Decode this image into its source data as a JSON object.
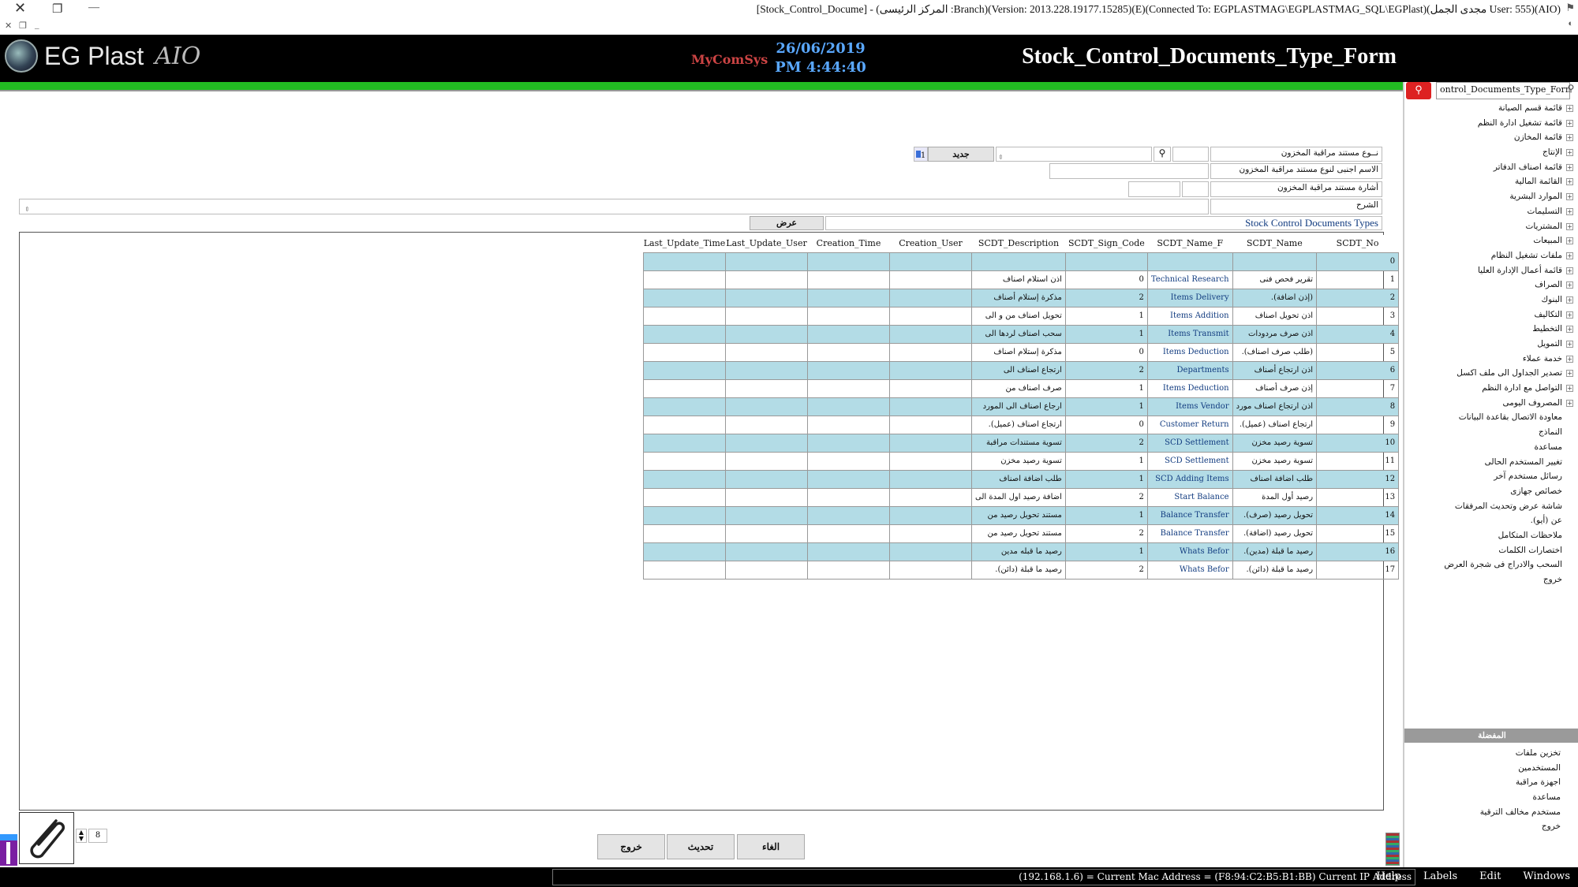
{
  "window": {
    "title": "[Stock_Control_Docume] - (المركز الرئيسى :Branch)(Version: 2013.228.19177.15285)(E)(Connected To: EGPLASTMAG\\EGPLASTMAG_SQL\\EGPlast)(مجدى الجمل User: 555)(AIO)",
    "close": "✕",
    "restore": "❐",
    "minimize": "—"
  },
  "header": {
    "logo_text": "EG Plast",
    "logo_suffix": "AIO",
    "brand": "MyComSys",
    "date": "26/06/2019",
    "time": "PM 4:44:40",
    "form_title": "Stock_Control_Documents_Type_Form"
  },
  "sidebar": {
    "search_value": "ontrol_Documents_Type_Form",
    "search_icon": "search-icon",
    "tree": [
      {
        "label": "قائمة قسم الصيانة",
        "expand": true
      },
      {
        "label": "قائمة تشغيل ادارة النظم",
        "expand": true
      },
      {
        "label": "قائمة المخازن",
        "expand": true
      },
      {
        "label": "الإنتاج",
        "expand": true
      },
      {
        "label": "قائمة اصناف الدفاتر",
        "expand": true
      },
      {
        "label": "القائمة المالية",
        "expand": true
      },
      {
        "label": "الموارد البشرية",
        "expand": true
      },
      {
        "label": "التسليمات",
        "expand": true
      },
      {
        "label": "المشتريات",
        "expand": true
      },
      {
        "label": "المبيعات",
        "expand": true
      },
      {
        "label": "ملفات تشغيل النظام",
        "expand": true
      },
      {
        "label": "قائمة أعمال الإدارة العليا",
        "expand": true
      },
      {
        "label": "الصراف",
        "expand": true
      },
      {
        "label": "البنوك",
        "expand": true
      },
      {
        "label": "التكاليف",
        "expand": true
      },
      {
        "label": "التخطيط",
        "expand": true
      },
      {
        "label": "التمويل",
        "expand": true
      },
      {
        "label": "خدمة عملاء",
        "expand": true
      },
      {
        "label": "تصدير الجداول الى ملف اكسل",
        "expand": true
      },
      {
        "label": "التواصل مع ادارة النظم",
        "expand": true
      },
      {
        "label": "المصروف اليومى",
        "expand": true
      },
      {
        "label": "معاودة الاتصال بقاعدة البيانات",
        "expand": false
      },
      {
        "label": "النماذج",
        "expand": false
      },
      {
        "label": "مساعدة",
        "expand": false
      },
      {
        "label": "تغيير المستخدم الحالى",
        "expand": false
      },
      {
        "label": "رسائل مستخدم آخر",
        "expand": false
      },
      {
        "label": "خصائص جهازى",
        "expand": false
      },
      {
        "label": "شاشة عرض وتحديث المرفقات",
        "expand": false
      },
      {
        "label": "عن (أيو).",
        "expand": false
      },
      {
        "label": "ملاحظات المتكامل",
        "expand": false
      },
      {
        "label": "اختصارات الكلمات",
        "expand": false
      },
      {
        "label": "السحب والادراج فى شجرة العرض",
        "expand": false
      },
      {
        "label": "خروج",
        "expand": false
      }
    ],
    "favorites_header": "المفضلة",
    "favorites": [
      "تخزين ملفات",
      "المستخدمين",
      "اجهزة مراقبة",
      "مساعدة",
      "مستخدم مخالف الترقية",
      "خروج"
    ]
  },
  "form": {
    "type_label": "نــوع مستند مراقبة المخزون",
    "foreign_name_label": "الاسم اجنبى لنوع مستند مراقبة المخزون",
    "sign_label": "أشارة مستند مراقبة المخزون",
    "description_label": "الشرح",
    "new_button": "جديد",
    "counter_value": "1",
    "grid_caption": "Stock Control Documents Types",
    "view_button": "عرض"
  },
  "grid": {
    "columns": [
      "Last_Update_Time",
      "Last_Update_User",
      "Creation_Time",
      "Creation_User",
      "SCDT_Description",
      "SCDT_Sign_Code",
      "SCDT_Name_F",
      "SCDT_Name",
      "SCDT_No"
    ],
    "rows": [
      {
        "no": "0",
        "name": "",
        "name_f": "",
        "sign": "",
        "desc": ""
      },
      {
        "no": "1",
        "name": "تقرير فحص فنى",
        "name_f": "Technical Research",
        "sign": "0",
        "desc": "اذن استلام اصناف"
      },
      {
        "no": "2",
        "name": "(إذن اضافة).",
        "name_f": "Items Delivery",
        "sign": "2",
        "desc": "مذكرة إستلام أصناف"
      },
      {
        "no": "3",
        "name": "اذن تحويل اصناف",
        "name_f": "Items Addition",
        "sign": "1",
        "desc": "تحويل اصناف من و الى"
      },
      {
        "no": "4",
        "name": "اذن صرف مردودات",
        "name_f": "Items Transmit",
        "sign": "1",
        "desc": "سحب اصناف لردها الى"
      },
      {
        "no": "5",
        "name": "(طلب صرف اصناف).",
        "name_f": "Items Deduction",
        "sign": "0",
        "desc": "مذكرة إستلام اصناف"
      },
      {
        "no": "6",
        "name": "اذن ارتجاع أصناف",
        "name_f": "Departments",
        "sign": "2",
        "desc": "ارتجاع اصناف الى"
      },
      {
        "no": "7",
        "name": "إذن صرف أصناف",
        "name_f": "Items Deduction",
        "sign": "1",
        "desc": "صرف اصناف من"
      },
      {
        "no": "8",
        "name": "اذن ارتجاع اصناف مورد",
        "name_f": "Items Vendor",
        "sign": "1",
        "desc": "ارجاع اصناف الى المورد"
      },
      {
        "no": "9",
        "name": "ارتجاع اصناف (عميل).",
        "name_f": "Customer Return",
        "sign": "0",
        "desc": "ارتجاع اصناف (عميل)."
      },
      {
        "no": "10",
        "name": "تسوية رصيد مخزن",
        "name_f": "SCD Settlement",
        "sign": "2",
        "desc": "تسوية مستندات مراقبة"
      },
      {
        "no": "11",
        "name": "تسوية رصيد مخزن",
        "name_f": "SCD Settlement",
        "sign": "1",
        "desc": "تسوية رصيد مخزن"
      },
      {
        "no": "12",
        "name": "طلب اضافة اصناف",
        "name_f": "SCD Adding Items",
        "sign": "1",
        "desc": "طلب اضافة اصناف"
      },
      {
        "no": "13",
        "name": "رصيد أول المدة",
        "name_f": "Start Balance",
        "sign": "2",
        "desc": "اضافة رصيد اول المدة الى"
      },
      {
        "no": "14",
        "name": "تحويل رصيد (صرف).",
        "name_f": "Balance Transfer",
        "sign": "1",
        "desc": "مستند تحويل رصيد من"
      },
      {
        "no": "15",
        "name": "تحويل رصيد (اضافة).",
        "name_f": "Balance Transfer",
        "sign": "2",
        "desc": "مستند تحويل رصيد من"
      },
      {
        "no": "16",
        "name": "رصيد ما قبلة (مدين).",
        "name_f": "Whats Befor",
        "sign": "1",
        "desc": "رصيد ما قبله مدين"
      },
      {
        "no": "17",
        "name": "رصيد ما قبلة (دائن).",
        "name_f": "Whats Befor",
        "sign": "2",
        "desc": "رصيد ما قبلة (دائن)."
      }
    ]
  },
  "bottom": {
    "page_value": "8",
    "exit_button": "خروج",
    "refresh_button": "تحديث",
    "cancel_button": "الغاء"
  },
  "statusbar": {
    "text": "(192.168.1.6) = Current Mac Address = (F8:94:C2:B5:B1:BB) Current IP Address",
    "menu": [
      "Help",
      "Labels",
      "Edit",
      "Windows"
    ]
  }
}
